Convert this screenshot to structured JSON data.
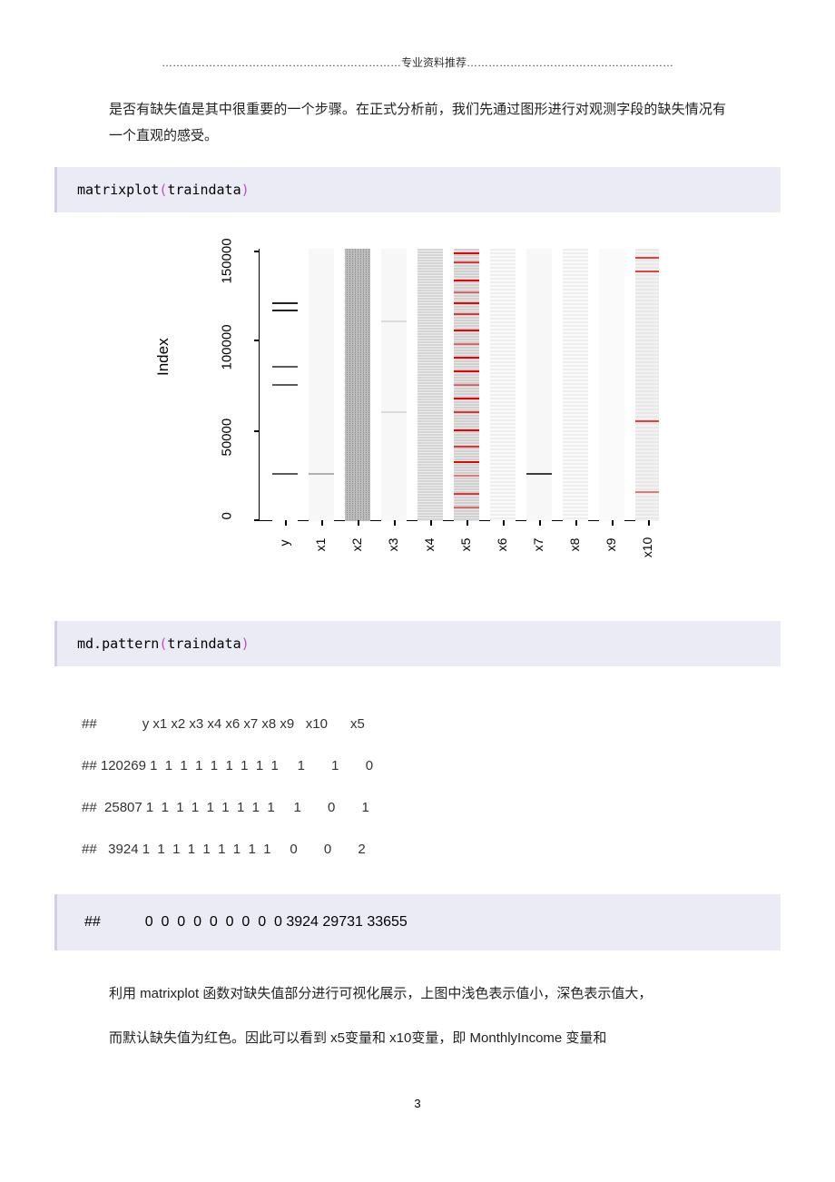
{
  "header": {
    "dots_left": "…………………………………………………………",
    "label": "专业资料推荐",
    "dots_right": "…………………………………………………"
  },
  "para1": "是否有缺失值是其中很重要的一个步骤。在正式分析前，我们先通过图形进行对观测字段的缺失情况有一个直观的感受。",
  "code1": {
    "fn": "matrixplot",
    "paren_l": "(",
    "arg": "traindata",
    "paren_r": ")"
  },
  "chart_data": {
    "type": "matrixplot-missing",
    "ylabel": "Index",
    "yticks": [
      "0",
      "50000",
      "100000",
      "150000"
    ],
    "xticks": [
      "y",
      "x1",
      "x2",
      "x3",
      "x4",
      "x5",
      "x6",
      "x7",
      "x8",
      "x9",
      "x10"
    ],
    "ylim": [
      0,
      150000
    ],
    "note": "grey density shows value magnitude, red marks missing values; x5 and x10 have visible missing (red) bands"
  },
  "code2": {
    "fn": "md.pattern",
    "paren_l": "(",
    "arg": "traindata",
    "paren_r": ")"
  },
  "output": {
    "header": "##            y x1 x2 x3 x4 x6 x7 x8 x9   x10      x5",
    "rows": [
      "## 120269 1  1  1  1  1  1  1  1  1     1       1       0",
      "##  25807 1  1  1  1  1  1  1  1  1     1       0       1",
      "##   3924 1  1  1  1  1  1  1  1  1     0       0       2"
    ],
    "footer": "##           0  0  0  0  0  0  0  0  0 3924 29731 33655"
  },
  "para2": "利用 matrixplot 函数对缺失值部分进行可视化展示，上图中浅色表示值小，深色表示值大，",
  "para3": "而默认缺失值为红色。因此可以看到 x5变量和 x10变量，即 MonthlyIncome 变量和",
  "page_number": "3"
}
